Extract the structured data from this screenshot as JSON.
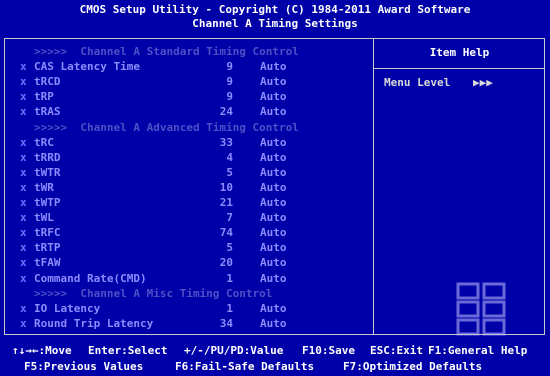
{
  "header": {
    "title": "CMOS Setup Utility - Copyright (C) 1984-2011 Award Software",
    "subtitle": "Channel A Timing Settings"
  },
  "settings": [
    {
      "type": "section",
      "label": ">>>>>  Channel A Standard Timing Control"
    },
    {
      "type": "item",
      "mark": "x",
      "label": "CAS Latency Time",
      "value": "9",
      "option": "Auto"
    },
    {
      "type": "item",
      "mark": "x",
      "label": "tRCD",
      "value": "9",
      "option": "Auto"
    },
    {
      "type": "item",
      "mark": "x",
      "label": "tRP",
      "value": "9",
      "option": "Auto"
    },
    {
      "type": "item",
      "mark": "x",
      "label": "tRAS",
      "value": "24",
      "option": "Auto"
    },
    {
      "type": "section",
      "label": ">>>>>  Channel A Advanced Timing Control"
    },
    {
      "type": "item",
      "mark": "x",
      "label": "tRC",
      "value": "33",
      "option": "Auto"
    },
    {
      "type": "item",
      "mark": "x",
      "label": "tRRD",
      "value": "4",
      "option": "Auto"
    },
    {
      "type": "item",
      "mark": "x",
      "label": "tWTR",
      "value": "5",
      "option": "Auto"
    },
    {
      "type": "item",
      "mark": "x",
      "label": "tWR",
      "value": "10",
      "option": "Auto"
    },
    {
      "type": "item",
      "mark": "x",
      "label": "tWTP",
      "value": "21",
      "option": "Auto"
    },
    {
      "type": "item",
      "mark": "x",
      "label": "tWL",
      "value": "7",
      "option": "Auto"
    },
    {
      "type": "item",
      "mark": "x",
      "label": "tRFC",
      "value": "74",
      "option": "Auto"
    },
    {
      "type": "item",
      "mark": "x",
      "label": "tRTP",
      "value": "5",
      "option": "Auto"
    },
    {
      "type": "item",
      "mark": "x",
      "label": "tFAW",
      "value": "20",
      "option": "Auto"
    },
    {
      "type": "item",
      "mark": "x",
      "label": "Command Rate(CMD)",
      "value": "1",
      "option": "Auto"
    },
    {
      "type": "section",
      "label": ">>>>>  Channel A Misc Timing Control"
    },
    {
      "type": "item",
      "mark": "x",
      "label": "IO Latency",
      "value": "1",
      "option": "Auto"
    },
    {
      "type": "item",
      "mark": "x",
      "label": "Round Trip Latency",
      "value": "34",
      "option": "Auto"
    }
  ],
  "help": {
    "title": "Item Help",
    "menu_level_label": "Menu Level",
    "menu_level_arrows": "▶▶▶"
  },
  "footer": {
    "move": "↑↓→←:Move",
    "select": "Enter:Select",
    "value": "+/-/PU/PD:Value",
    "save": "F10:Save",
    "exit": "ESC:Exit",
    "general_help": "F1:General Help",
    "previous": "F5:Previous Values",
    "failsafe": "F6:Fail-Safe Defaults",
    "optimized": "F7:Optimized Defaults"
  },
  "colors": {
    "background": "#0000a8",
    "header_text": "#ffffff",
    "disabled_text": "#8c8cff",
    "section_text": "#4f4fc8",
    "frame": "#c8c8c8"
  },
  "watermark_icon": "ferra-logo-watermark"
}
